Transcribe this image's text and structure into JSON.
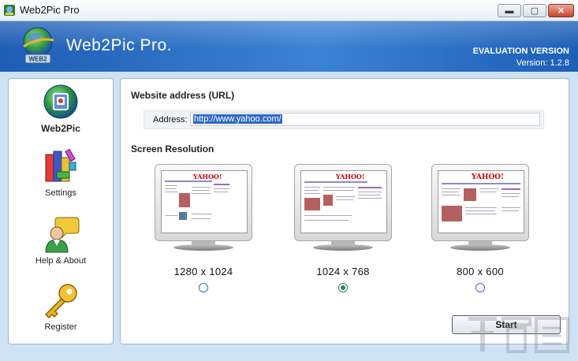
{
  "window": {
    "title": "Web2Pic Pro",
    "minimize_label": "▬",
    "maximize_label": "▢",
    "close_label": "✕"
  },
  "banner": {
    "app_name": "Web2Pic Pro.",
    "edition": "EVALUATION VERSION",
    "version": "Version: 1.2.8",
    "logo_text": "WEB2"
  },
  "sidebar": {
    "items": [
      {
        "label": "Web2Pic",
        "icon": "globe-photo-icon",
        "active": true
      },
      {
        "label": "Settings",
        "icon": "settings-blocks-icon",
        "active": false
      },
      {
        "label": "Help & About",
        "icon": "help-person-icon",
        "active": false
      },
      {
        "label": "Register",
        "icon": "key-icon",
        "active": false
      }
    ]
  },
  "main": {
    "url_section_title": "Website address (URL)",
    "address_label": "Address:",
    "address_value": "http://www.yahoo.com/",
    "resolution_section_title": "Screen Resolution",
    "resolutions": [
      {
        "label": "1280 x 1024",
        "selected": false
      },
      {
        "label": "1024 x 768",
        "selected": true
      },
      {
        "label": "800 x 600",
        "selected": false
      }
    ],
    "thumbnail_logo": "YAHOO!",
    "start_label": "Start"
  }
}
